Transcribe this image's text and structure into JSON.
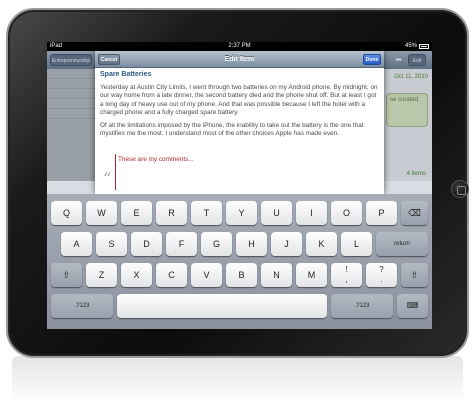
{
  "status_bar": {
    "carrier": "iPad",
    "time": "2:37 PM",
    "battery": "45%"
  },
  "background_app": {
    "back_label": "Entrepreneurship",
    "edit_label": "Edit",
    "date": "Oct 11, 2010",
    "curated": "se curated",
    "items": "4 items"
  },
  "modal": {
    "title": "Edit Item",
    "cancel_label": "Cancel",
    "done_label": "Done",
    "item_title": "Spare Batteries",
    "paragraph1": "Yesterday at Austin City Limits, I went through two batteries on my Android phone. By midnight, on our way home from a late dinner, the second battery died and the phone shut off. But at least I got a long day of heavy use out of my phone. And that was possible because I left the hotel with a charged phone and a fully charged spare battery.",
    "paragraph2": "Of all the limitations imposed by the iPhone, the inability to take out the battery is the one that mystifies me the most. I understand most of the other choices Apple has made even.",
    "comment": "These are my comments...",
    "quote_glyph": "“"
  },
  "keyboard": {
    "row1": [
      "Q",
      "W",
      "E",
      "R",
      "T",
      "Y",
      "U",
      "I",
      "O",
      "P"
    ],
    "row2": [
      "A",
      "S",
      "D",
      "F",
      "G",
      "H",
      "J",
      "K",
      "L"
    ],
    "row3": [
      "Z",
      "X",
      "C",
      "V",
      "B",
      "N",
      "M"
    ],
    "return_label": "return",
    "numbers_label": ".?123",
    "excl": "!\n,",
    "quest": "?\n.",
    "shift_glyph": "⇧",
    "delete_glyph": "⌫",
    "hide_glyph": "⌨"
  },
  "icons": {
    "shift": "shift-icon",
    "delete": "delete-icon",
    "hide": "keyboard-hide-icon",
    "quote": "quote-icon"
  }
}
